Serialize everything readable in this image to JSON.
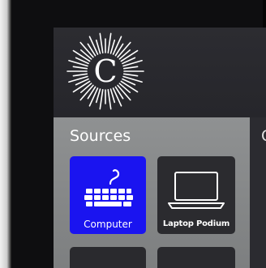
{
  "logo": {
    "letter": "C",
    "icon": "sunburst-logo-icon"
  },
  "sources": {
    "title": "Sources",
    "items": [
      {
        "label": "Computer",
        "icon": "keyboard-icon",
        "selected": true,
        "color": "#1a14f0"
      },
      {
        "label": "Laptop Podium",
        "icon": "laptop-icon",
        "selected": false,
        "color": "#2b2b2f"
      }
    ]
  },
  "right_panel": {
    "title_fragment": "C"
  },
  "colors": {
    "selected_tile": "#1a14f0",
    "panel": "#8f9192",
    "header": "#2c2c31"
  }
}
